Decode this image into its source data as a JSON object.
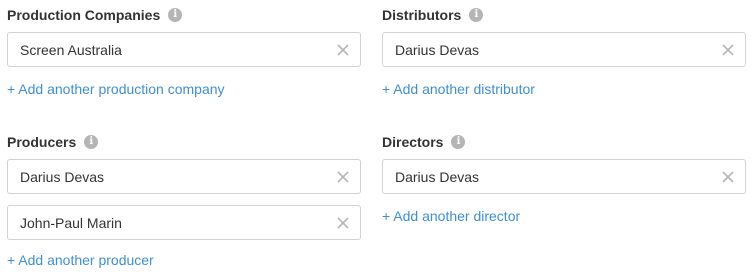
{
  "production_companies": {
    "label": "Production Companies",
    "entries": [
      "Screen Australia"
    ],
    "add_link": "+ Add another production company"
  },
  "distributors": {
    "label": "Distributors",
    "entries": [
      "Darius Devas"
    ],
    "add_link": "+ Add another distributor"
  },
  "producers": {
    "label": "Producers",
    "entries": [
      "Darius Devas",
      "John-Paul Marin"
    ],
    "add_link": "+ Add another producer"
  },
  "directors": {
    "label": "Directors",
    "entries": [
      "Darius Devas"
    ],
    "add_link": "+ Add another director"
  },
  "icons": {
    "info": "info-icon",
    "clear": "close-icon"
  },
  "info_glyph": "i",
  "colors": {
    "link": "#3f8fd0",
    "label": "#333333",
    "border": "#d2d2d2",
    "icon": "#b5b5b5"
  }
}
